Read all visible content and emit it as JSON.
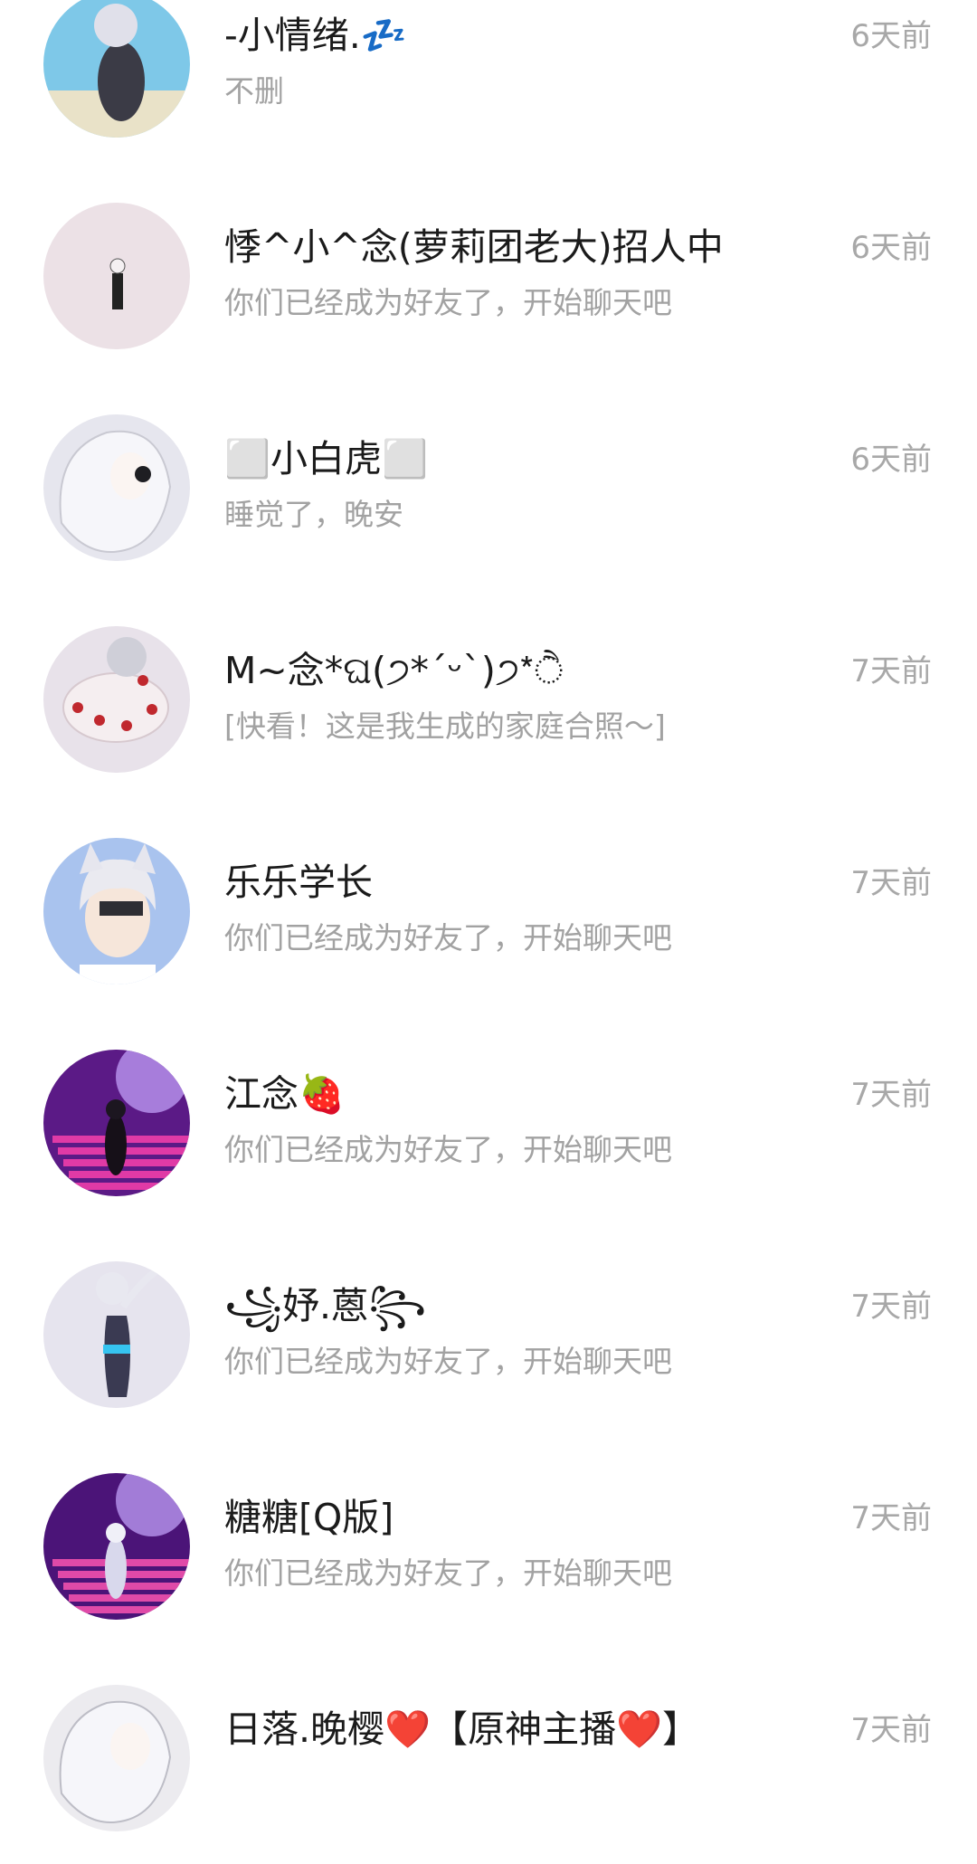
{
  "conversations": [
    {
      "name": "-小情绪.💤",
      "message": "不删",
      "time": "6天前",
      "avatar": {
        "icon": "avatar-anime-girl-beach",
        "bg": "#7ec8e8",
        "accent": "#3b3b46"
      }
    },
    {
      "name": "悸^小^念(萝莉团老大)招人中",
      "message": "你们已经成为好友了，开始聊天吧",
      "time": "6天前",
      "avatar": {
        "icon": "avatar-small-figure",
        "bg": "#ece1e6",
        "accent": "#222222"
      }
    },
    {
      "name": "⬜小白虎⬜",
      "message": "睡觉了，晚安",
      "time": "6天前",
      "avatar": {
        "icon": "avatar-white-hair-character",
        "bg": "#e6e6ee",
        "accent": "#c9c9d2"
      }
    },
    {
      "name": "M~念*ଘ(੭*ˊᵕˋ)੭*ੈ",
      "message": "[快看！这是我生成的家庭合照～]",
      "time": "7天前",
      "avatar": {
        "icon": "avatar-lolita-dress-character",
        "bg": "#e8e2ea",
        "accent": "#c0282e"
      }
    },
    {
      "name": "乐乐学长",
      "message": "你们已经成为好友了，开始聊天吧",
      "time": "7天前",
      "avatar": {
        "icon": "avatar-cat-ear-boy",
        "bg": "#a9c3ee",
        "accent": "#2e2e33"
      }
    },
    {
      "name": "江念🍓",
      "message": "你们已经成为好友了，开始聊天吧",
      "time": "7天前",
      "avatar": {
        "icon": "avatar-stage-purple",
        "bg": "#5b1a86",
        "accent": "#e03aa6"
      }
    },
    {
      "name": "꧁妤.蒽꧂",
      "message": "你们已经成为好友了，开始聊天吧",
      "time": "7天前",
      "avatar": {
        "icon": "avatar-dancing-character",
        "bg": "#e6e4ee",
        "accent": "#3a3a52"
      }
    },
    {
      "name": "糖糖[Q版]",
      "message": "你们已经成为好友了，开始聊天吧",
      "time": "7天前",
      "avatar": {
        "icon": "avatar-stage-purple-small",
        "bg": "#4b1478",
        "accent": "#e04aa8"
      }
    },
    {
      "name": "日落.晚樱❤️【原神主播❤️】",
      "message": "",
      "time": "7天前",
      "avatar": {
        "icon": "avatar-white-hair-partial",
        "bg": "#ecebef",
        "accent": "#bdbdc6"
      }
    }
  ]
}
